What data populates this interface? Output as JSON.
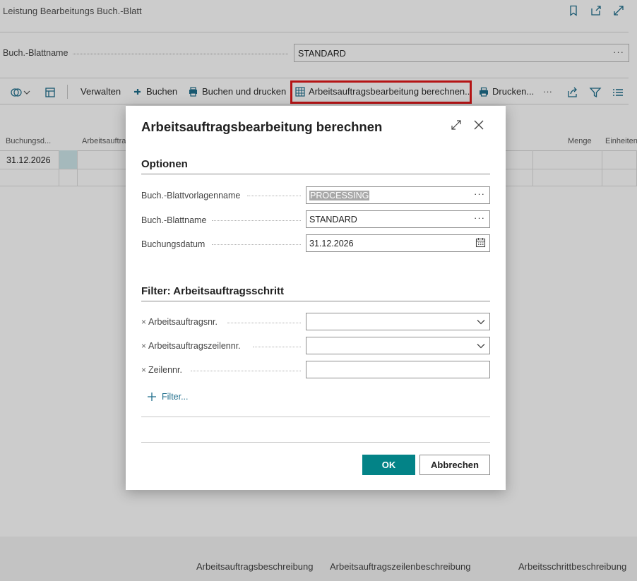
{
  "page": {
    "title": "Leistung Bearbeitungs Buch.-Blatt",
    "batch_name_label": "Buch.-Blattname",
    "batch_name_value": "STANDARD",
    "icons": [
      "bookmark-icon",
      "share-icon",
      "expand-icon"
    ]
  },
  "toolbar": {
    "manage": "Verwalten",
    "post": "Buchen",
    "post_print": "Buchen und drucken",
    "calc_work_order": "Arbeitsauftragsbearbeitung berechnen...",
    "print": "Drucken...",
    "more": "···",
    "highlight_color": "#e3191b"
  },
  "grid": {
    "headers": [
      "Buchungsd...",
      "Arbeitsauftra",
      "Menge",
      "Einheiten"
    ],
    "rows": [
      [
        "31.12.2026"
      ]
    ]
  },
  "bottom_labels": [
    "Arbeitsauftragsbeschreibung",
    "Arbeitsauftragszeilenbeschreibung",
    "Arbeitsschrittbeschreibung"
  ],
  "dialog": {
    "title": "Arbeitsauftragsbearbeitung berechnen",
    "options_heading": "Optionen",
    "fields": {
      "template_label": "Buch.-Blattvorlagenname",
      "template_value": "PROCESSING",
      "batch_label": "Buch.-Blattname",
      "batch_value": "STANDARD",
      "date_label": "Buchungsdatum",
      "date_value": "31.12.2026"
    },
    "filter_heading": "Filter: Arbeitsauftragsschritt",
    "filters": {
      "order_no": "Arbeitsauftragsnr.",
      "order_line_no": "Arbeitsauftragszeilennr.",
      "line_no": "Zeilennr."
    },
    "remove_glyph": "×",
    "add_filter": "Filter...",
    "ok": "OK",
    "cancel": "Abbrechen",
    "accent": "#038387"
  }
}
